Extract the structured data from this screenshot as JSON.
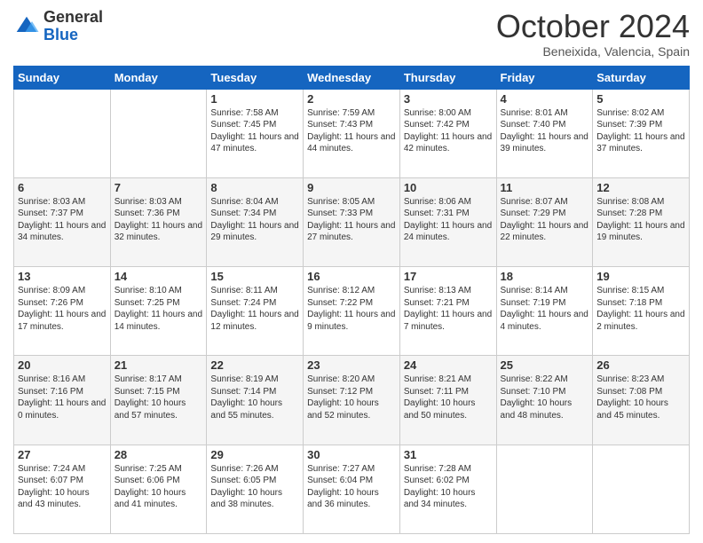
{
  "header": {
    "logo": {
      "line1": "General",
      "line2": "Blue"
    },
    "title": "October 2024",
    "location": "Beneixida, Valencia, Spain"
  },
  "days": [
    "Sunday",
    "Monday",
    "Tuesday",
    "Wednesday",
    "Thursday",
    "Friday",
    "Saturday"
  ],
  "weeks": [
    [
      {
        "day": "",
        "content": ""
      },
      {
        "day": "",
        "content": ""
      },
      {
        "day": "1",
        "content": "Sunrise: 7:58 AM\nSunset: 7:45 PM\nDaylight: 11 hours and 47 minutes."
      },
      {
        "day": "2",
        "content": "Sunrise: 7:59 AM\nSunset: 7:43 PM\nDaylight: 11 hours and 44 minutes."
      },
      {
        "day": "3",
        "content": "Sunrise: 8:00 AM\nSunset: 7:42 PM\nDaylight: 11 hours and 42 minutes."
      },
      {
        "day": "4",
        "content": "Sunrise: 8:01 AM\nSunset: 7:40 PM\nDaylight: 11 hours and 39 minutes."
      },
      {
        "day": "5",
        "content": "Sunrise: 8:02 AM\nSunset: 7:39 PM\nDaylight: 11 hours and 37 minutes."
      }
    ],
    [
      {
        "day": "6",
        "content": "Sunrise: 8:03 AM\nSunset: 7:37 PM\nDaylight: 11 hours and 34 minutes."
      },
      {
        "day": "7",
        "content": "Sunrise: 8:03 AM\nSunset: 7:36 PM\nDaylight: 11 hours and 32 minutes."
      },
      {
        "day": "8",
        "content": "Sunrise: 8:04 AM\nSunset: 7:34 PM\nDaylight: 11 hours and 29 minutes."
      },
      {
        "day": "9",
        "content": "Sunrise: 8:05 AM\nSunset: 7:33 PM\nDaylight: 11 hours and 27 minutes."
      },
      {
        "day": "10",
        "content": "Sunrise: 8:06 AM\nSunset: 7:31 PM\nDaylight: 11 hours and 24 minutes."
      },
      {
        "day": "11",
        "content": "Sunrise: 8:07 AM\nSunset: 7:29 PM\nDaylight: 11 hours and 22 minutes."
      },
      {
        "day": "12",
        "content": "Sunrise: 8:08 AM\nSunset: 7:28 PM\nDaylight: 11 hours and 19 minutes."
      }
    ],
    [
      {
        "day": "13",
        "content": "Sunrise: 8:09 AM\nSunset: 7:26 PM\nDaylight: 11 hours and 17 minutes."
      },
      {
        "day": "14",
        "content": "Sunrise: 8:10 AM\nSunset: 7:25 PM\nDaylight: 11 hours and 14 minutes."
      },
      {
        "day": "15",
        "content": "Sunrise: 8:11 AM\nSunset: 7:24 PM\nDaylight: 11 hours and 12 minutes."
      },
      {
        "day": "16",
        "content": "Sunrise: 8:12 AM\nSunset: 7:22 PM\nDaylight: 11 hours and 9 minutes."
      },
      {
        "day": "17",
        "content": "Sunrise: 8:13 AM\nSunset: 7:21 PM\nDaylight: 11 hours and 7 minutes."
      },
      {
        "day": "18",
        "content": "Sunrise: 8:14 AM\nSunset: 7:19 PM\nDaylight: 11 hours and 4 minutes."
      },
      {
        "day": "19",
        "content": "Sunrise: 8:15 AM\nSunset: 7:18 PM\nDaylight: 11 hours and 2 minutes."
      }
    ],
    [
      {
        "day": "20",
        "content": "Sunrise: 8:16 AM\nSunset: 7:16 PM\nDaylight: 11 hours and 0 minutes."
      },
      {
        "day": "21",
        "content": "Sunrise: 8:17 AM\nSunset: 7:15 PM\nDaylight: 10 hours and 57 minutes."
      },
      {
        "day": "22",
        "content": "Sunrise: 8:19 AM\nSunset: 7:14 PM\nDaylight: 10 hours and 55 minutes."
      },
      {
        "day": "23",
        "content": "Sunrise: 8:20 AM\nSunset: 7:12 PM\nDaylight: 10 hours and 52 minutes."
      },
      {
        "day": "24",
        "content": "Sunrise: 8:21 AM\nSunset: 7:11 PM\nDaylight: 10 hours and 50 minutes."
      },
      {
        "day": "25",
        "content": "Sunrise: 8:22 AM\nSunset: 7:10 PM\nDaylight: 10 hours and 48 minutes."
      },
      {
        "day": "26",
        "content": "Sunrise: 8:23 AM\nSunset: 7:08 PM\nDaylight: 10 hours and 45 minutes."
      }
    ],
    [
      {
        "day": "27",
        "content": "Sunrise: 7:24 AM\nSunset: 6:07 PM\nDaylight: 10 hours and 43 minutes."
      },
      {
        "day": "28",
        "content": "Sunrise: 7:25 AM\nSunset: 6:06 PM\nDaylight: 10 hours and 41 minutes."
      },
      {
        "day": "29",
        "content": "Sunrise: 7:26 AM\nSunset: 6:05 PM\nDaylight: 10 hours and 38 minutes."
      },
      {
        "day": "30",
        "content": "Sunrise: 7:27 AM\nSunset: 6:04 PM\nDaylight: 10 hours and 36 minutes."
      },
      {
        "day": "31",
        "content": "Sunrise: 7:28 AM\nSunset: 6:02 PM\nDaylight: 10 hours and 34 minutes."
      },
      {
        "day": "",
        "content": ""
      },
      {
        "day": "",
        "content": ""
      }
    ]
  ]
}
